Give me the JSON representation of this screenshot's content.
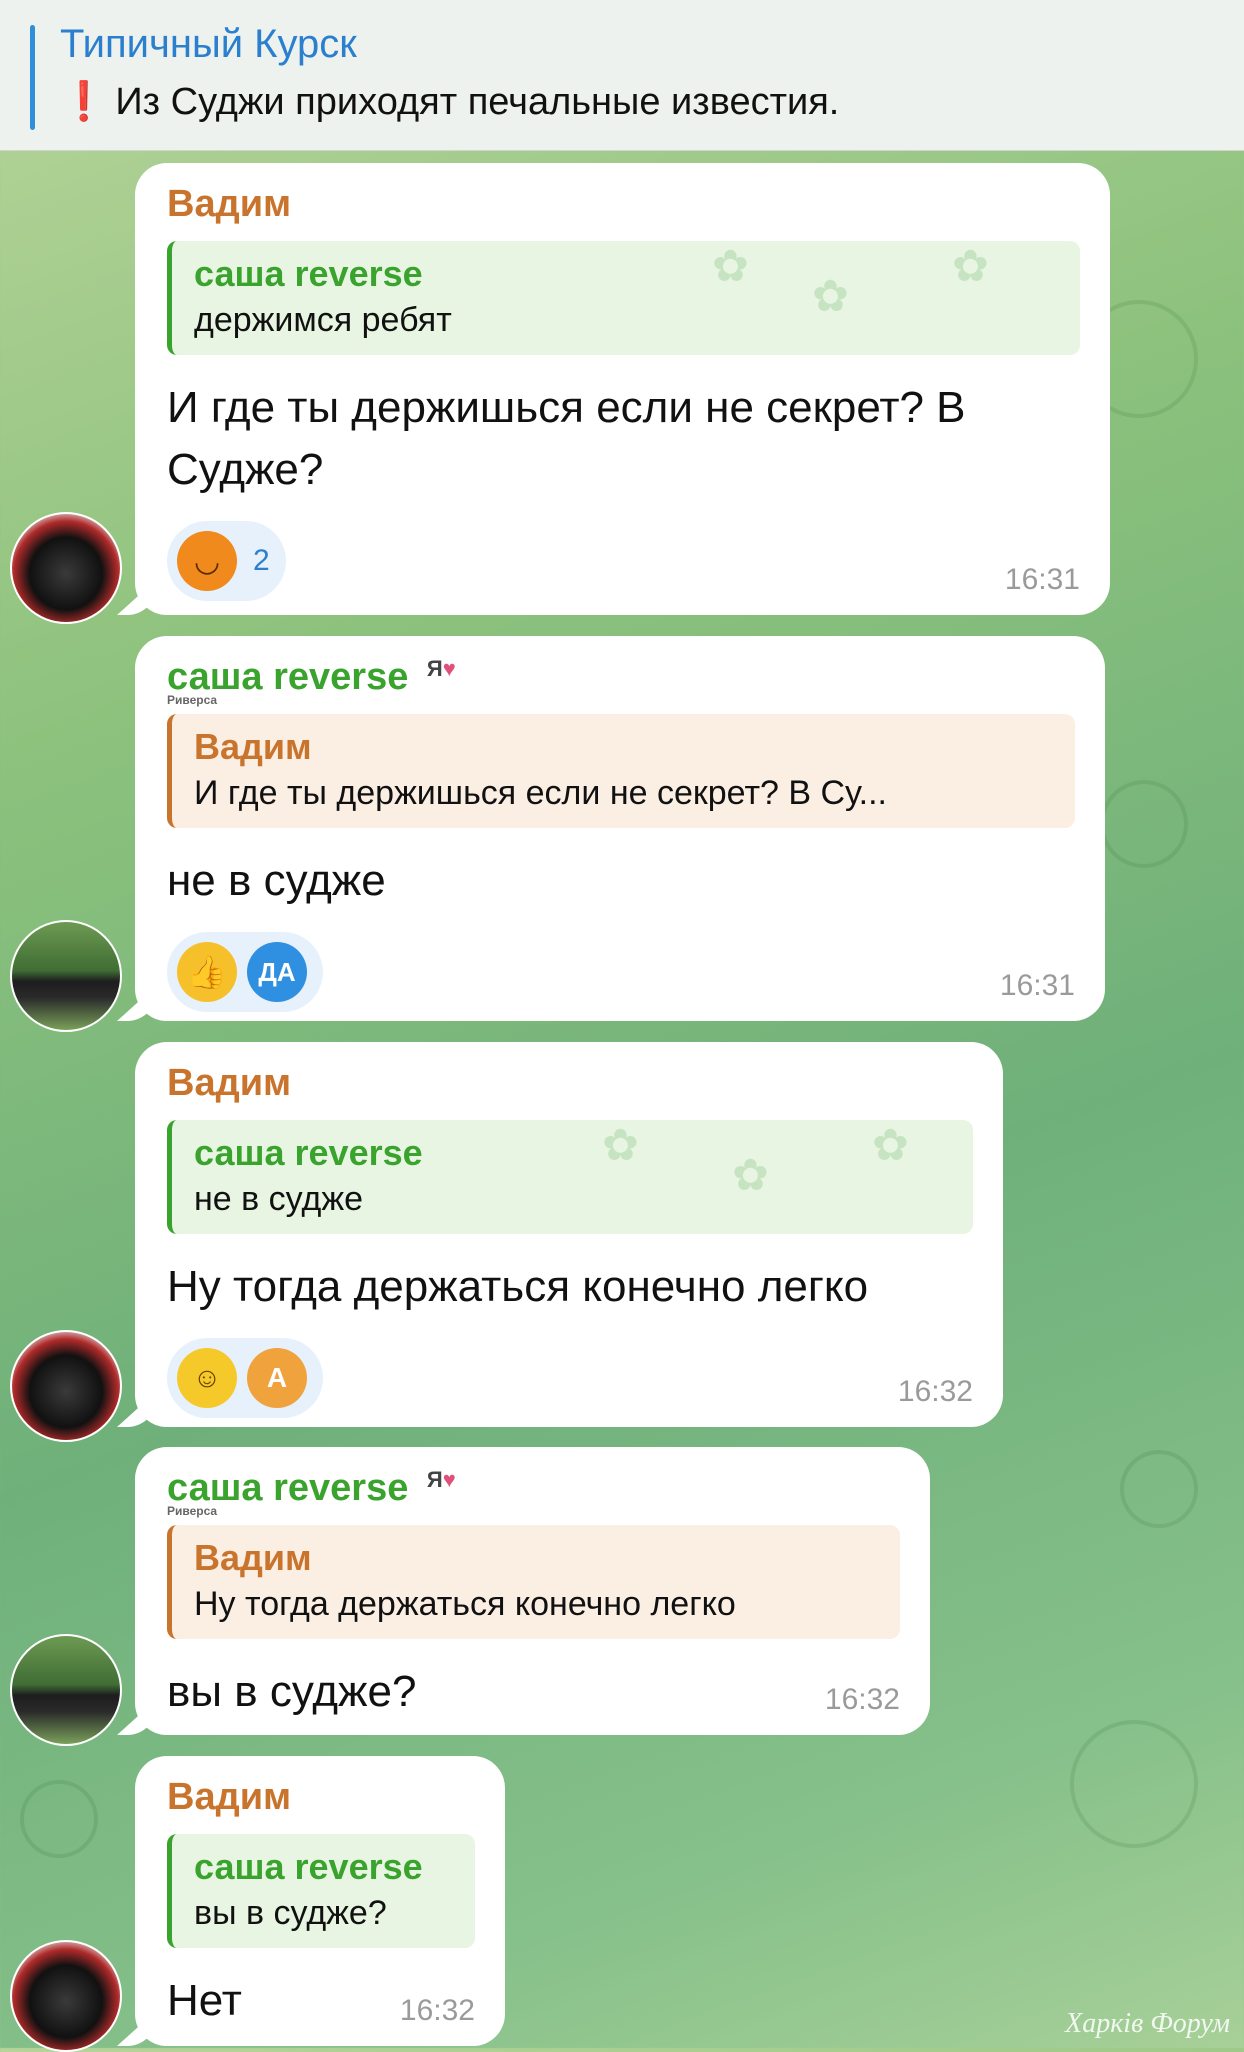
{
  "pinned": {
    "channel": "Типичный Курск",
    "text": "Из Суджи приходят печальные известия."
  },
  "messages": [
    {
      "sender": "Вадим",
      "reply_name": "саша reverse",
      "reply_text": "держимся ребят",
      "text": "И где ты держишься если не секрет? В Суджe?",
      "reaction_count": "2",
      "time": "16:31"
    },
    {
      "sender": "саша reverse",
      "badge": "Я",
      "badge_sub": "Риверса",
      "reply_name": "Вадим",
      "reply_text": "И где ты держишься если не секрет? В Су...",
      "text": "не в судже",
      "reactor": "ДА",
      "time": "16:31"
    },
    {
      "sender": "Вадим",
      "reply_name": "саша reverse",
      "reply_text": "не в судже",
      "text": "Ну тогда держаться конечно легко",
      "reactor": "А",
      "time": "16:32"
    },
    {
      "sender": "саша reverse",
      "badge": "Я",
      "badge_sub": "Риверса",
      "reply_name": "Вадим",
      "reply_text": "Ну тогда держаться конечно легко",
      "text": "вы в судже?",
      "time": "16:32"
    },
    {
      "sender": "Вадим",
      "reply_name": "саша reverse",
      "reply_text": "вы в судже?",
      "text": "Нет",
      "time": "16:32"
    }
  ],
  "watermark": "Харків Форум"
}
